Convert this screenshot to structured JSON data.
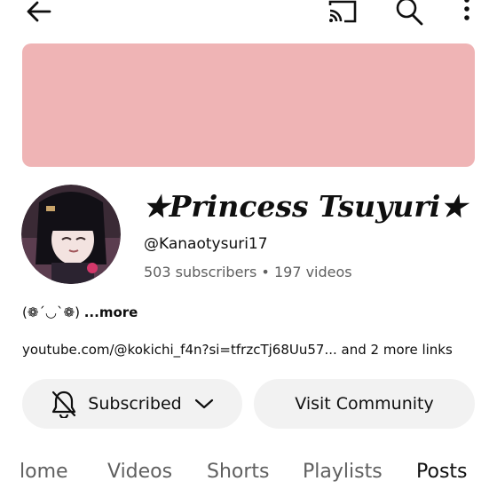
{
  "header": {
    "back_icon": "arrow-left-icon",
    "cast_icon": "cast-icon",
    "search_icon": "search-icon",
    "more_icon": "more-vertical-icon"
  },
  "banner": {
    "color": "#efb4b5"
  },
  "channel": {
    "name": "★Princess Tsuyuri★",
    "handle": "@Kanaotysuri17",
    "subscribers": "503 subscribers",
    "separator": "•",
    "videos": "197 videos",
    "description": "(❁´◡`❁)",
    "description_more": "...more",
    "link_text": "youtube.com/@kokichi_f4n?si=tfrzcTj68Uu57...",
    "more_links": "and 2 more links"
  },
  "actions": {
    "subscribed_label": "Subscribed",
    "visit_label": "Visit Community"
  },
  "tabs": [
    {
      "label": "Home",
      "shown": "lome"
    },
    {
      "label": "Videos"
    },
    {
      "label": "Shorts"
    },
    {
      "label": "Playlists"
    },
    {
      "label": "Posts",
      "active": true
    }
  ]
}
